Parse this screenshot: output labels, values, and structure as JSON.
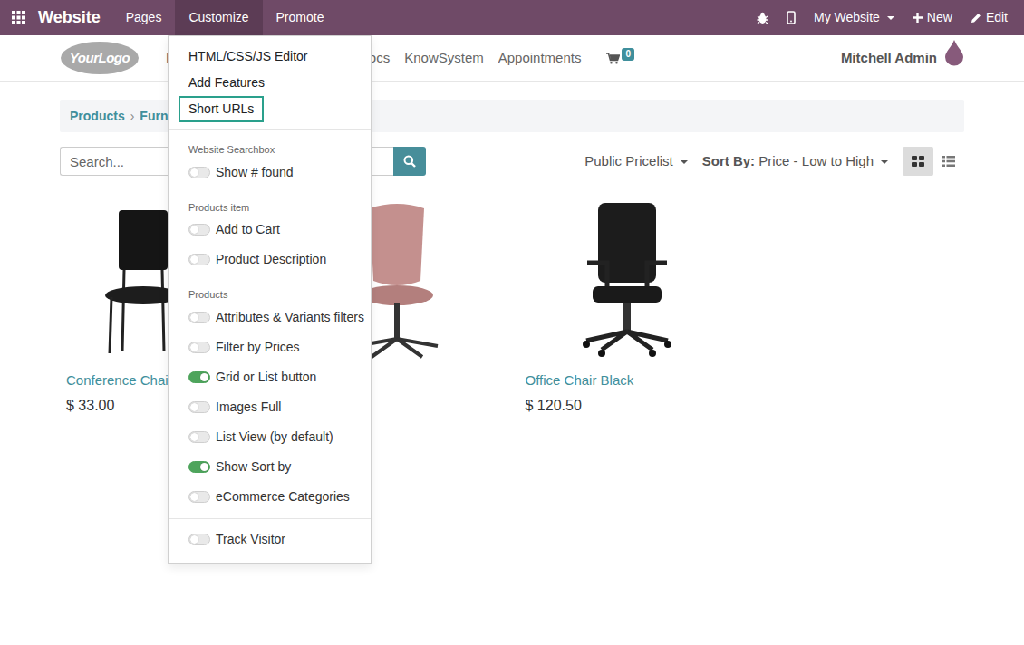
{
  "top_bar": {
    "brand": "Website",
    "menus": [
      {
        "label": "Pages",
        "selected": false
      },
      {
        "label": "Customize",
        "selected": true
      },
      {
        "label": "Promote",
        "selected": false
      }
    ],
    "website": "My Website",
    "new": "New",
    "edit": "Edit"
  },
  "header": {
    "logo": "YourLogo",
    "menu": [
      "H",
      "ocs",
      "KnowSystem",
      "Appointments"
    ],
    "cart_count": "0",
    "user": "Mitchell Admin"
  },
  "breadcrumb": {
    "items": [
      "Products",
      "Furnitu"
    ],
    "separator": "›"
  },
  "shop": {
    "search": {
      "placeholder": "Search..."
    },
    "pricelist": "Public Pricelist",
    "sort_label": "Sort By:",
    "sort_value": "Price - Low to High",
    "view_toggles": [
      {
        "kind": "grid",
        "selected": true
      },
      {
        "kind": "list",
        "selected": false
      }
    ]
  },
  "products": [
    {
      "kind": "side-chair",
      "name": "Conference Chair",
      "price": "$ 33.00"
    },
    {
      "kind": "swivel-chair"
    },
    {
      "kind": "office-chair",
      "name": "Office Chair Black",
      "price": "$ 120.50"
    }
  ],
  "customize_menu": {
    "links": [
      {
        "label": "HTML/CSS/JS Editor",
        "selected": false
      },
      {
        "label": "Add Features",
        "selected": false
      },
      {
        "label": "Short URLs",
        "selected": true
      }
    ],
    "sections": [
      {
        "title": "Website Searchbox",
        "options": [
          {
            "label": "Show # found",
            "on": false
          }
        ]
      },
      {
        "title": "Products item",
        "options": [
          {
            "label": "Add to Cart",
            "on": false
          },
          {
            "label": "Product Description",
            "on": false
          }
        ]
      },
      {
        "title": "Products",
        "options": [
          {
            "label": "Attributes & Variants filters",
            "on": false
          },
          {
            "label": "Filter by Prices",
            "on": false
          },
          {
            "label": "Grid or List button",
            "on": true
          },
          {
            "label": "Images Full",
            "on": false
          },
          {
            "label": "List View (by default)",
            "on": false
          },
          {
            "label": "Show Sort by",
            "on": true
          },
          {
            "label": "eCommerce Categories",
            "on": false
          }
        ]
      },
      {
        "options": [
          {
            "label": "Track Visitor",
            "on": false
          }
        ]
      }
    ]
  }
}
